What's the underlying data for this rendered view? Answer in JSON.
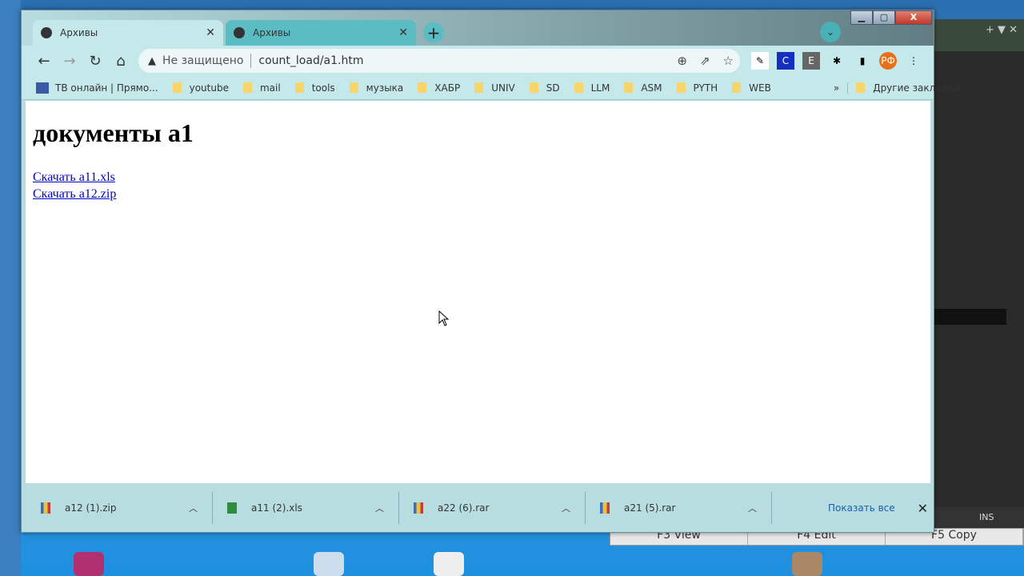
{
  "tabs": [
    {
      "label": "Архивы",
      "active": true
    },
    {
      "label": "Архивы",
      "active": false
    }
  ],
  "address": {
    "security": "Не защищено",
    "url": "count_load/a1.htm"
  },
  "bookmarks": [
    "ТВ онлайн | Прямо...",
    "youtube",
    "mail",
    "tools",
    "музыка",
    "ХАБР",
    "UNIV",
    "SD",
    "LLM",
    "ASM",
    "PYTH",
    "WEB"
  ],
  "other_bookmarks": "Другие закладки",
  "extensions": {
    "c": "C",
    "e": "E",
    "profile": "РФ"
  },
  "page": {
    "heading": "документы a1",
    "links": [
      "Скачать a11.xls",
      "Скачать a12.zip"
    ]
  },
  "downloads": [
    {
      "name": "a12 (1).zip",
      "type": "archive"
    },
    {
      "name": "a11 (2).xls",
      "type": "xls"
    },
    {
      "name": "a22 (6).rar",
      "type": "archive"
    },
    {
      "name": "a21 (5).rar",
      "type": "archive"
    }
  ],
  "show_all": "Показать все",
  "background_app": {
    "status": "INS",
    "fkeys": [
      "F3 View",
      "F4 Edit",
      "F5 Copy"
    ]
  }
}
